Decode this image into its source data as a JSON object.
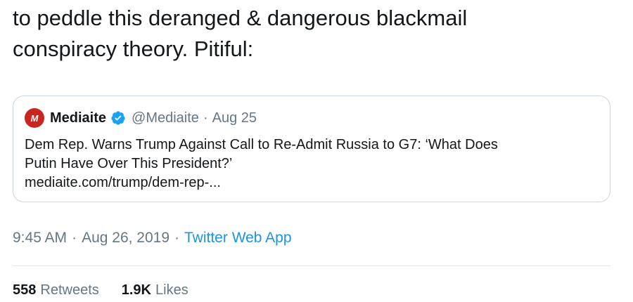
{
  "tweet": {
    "text_lines": [
      "to peddle this deranged & dangerous blackmail",
      "conspiracy theory. Pitiful:"
    ]
  },
  "quote": {
    "avatar_icon": "mediaite-logo-icon",
    "avatar_letter": "M",
    "avatar_color": "#c8261e",
    "name": "Mediaite",
    "verified_icon": "verified-badge-icon",
    "verified_color": "#1da1f2",
    "handle": "@Mediaite",
    "separator": "·",
    "date": "Aug 25",
    "body_lines": [
      "Dem Rep. Warns Trump Against Call to Re-Admit Russia to G7: ‘What Does",
      "Putin Have Over This President?’",
      "mediaite.com/trump/dem-rep-..."
    ]
  },
  "meta": {
    "time": "9:45 AM",
    "separator": "·",
    "date": "Aug 26, 2019",
    "source": "Twitter Web App",
    "source_color": "#1b95e0"
  },
  "stats": {
    "retweets_count": "558",
    "retweets_label": "Retweets",
    "likes_count": "1.9K",
    "likes_label": "Likes"
  }
}
